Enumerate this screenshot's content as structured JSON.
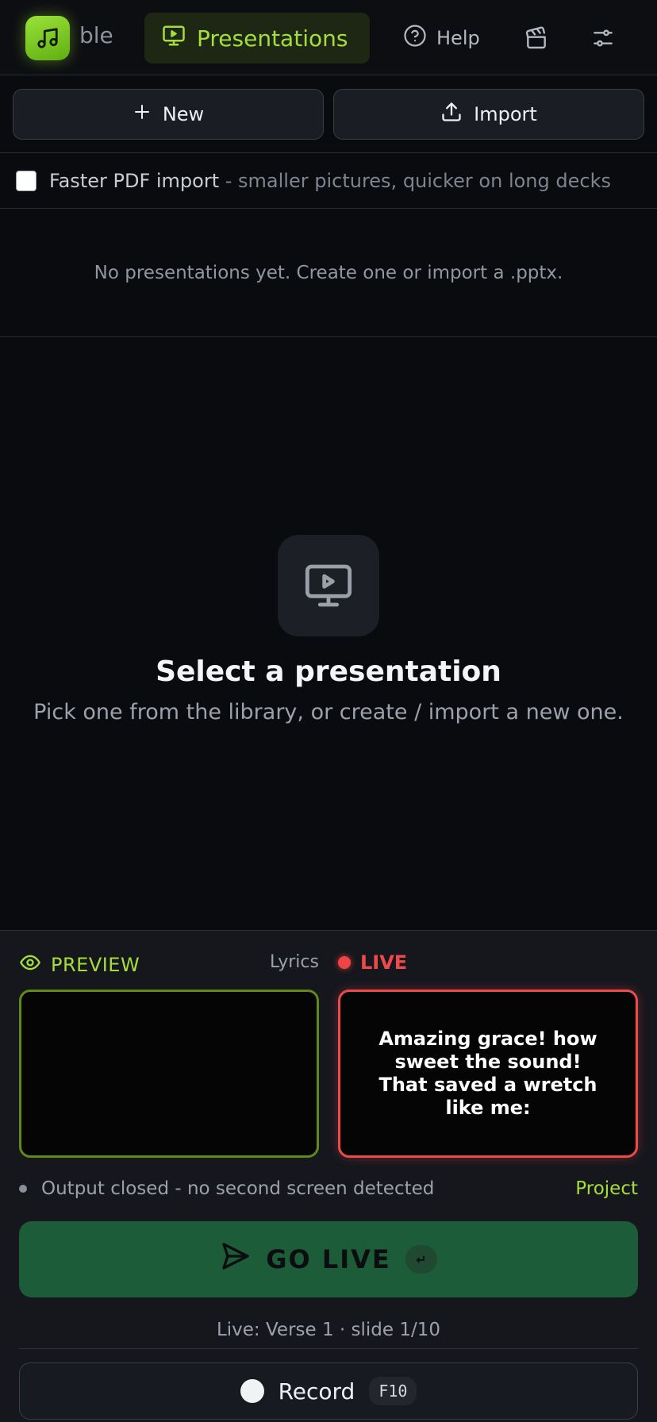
{
  "nav": {
    "songs_partial": "ble",
    "presentations": "Presentations",
    "help": "Help"
  },
  "actions": {
    "new_label": "New",
    "import_label": "Import"
  },
  "pdf_option": {
    "label": "Faster PDF import",
    "hint": " - smaller pictures, quicker on long decks",
    "checked": false
  },
  "library": {
    "empty_text": "No presentations yet. Create one or import a .pptx."
  },
  "placeholder": {
    "title": "Select a presentation",
    "subtitle": "Pick one from the library, or create / import a new one."
  },
  "output": {
    "preview_label": "PREVIEW",
    "lyrics_label": "Lyrics",
    "live_label": "LIVE",
    "live_text": "Amazing grace! how sweet the sound! That saved a wretch like me:",
    "status": "Output closed - no second screen detected",
    "project_link": "Project",
    "go_live": "GO LIVE",
    "go_live_key": "↵",
    "live_info": "Live: Verse 1 · slide 1/10",
    "record": "Record",
    "record_key": "F10"
  },
  "colors": {
    "accent": "#a5de3a",
    "live": "#ef4a4a",
    "go_live_bg": "#1c5c38",
    "background": "#0a0b0e"
  }
}
